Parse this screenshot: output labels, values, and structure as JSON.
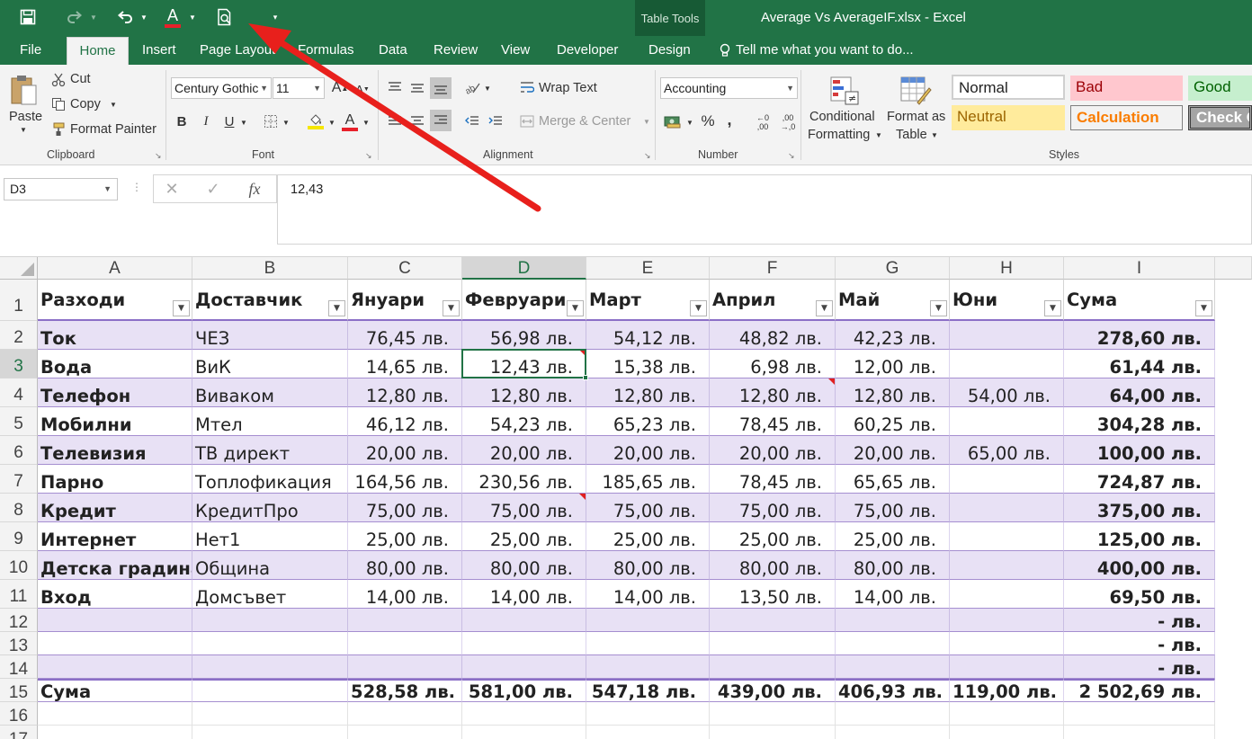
{
  "window": {
    "title": "Average Vs AverageIF.xlsx - Excel",
    "contextual_label": "Table Tools",
    "brand_color": "#217346"
  },
  "quick_access": {
    "icons": [
      "save-icon",
      "redo-icon",
      "undo-icon",
      "font-color-icon",
      "print-preview-icon",
      "customize-qat-icon"
    ]
  },
  "tabs": {
    "file": "File",
    "home": "Home",
    "insert": "Insert",
    "page_layout": "Page Layout",
    "formulas": "Formulas",
    "data": "Data",
    "review": "Review",
    "view": "View",
    "developer": "Developer",
    "design": "Design",
    "tell_me": "Tell me what you want to do..."
  },
  "ribbon": {
    "clipboard": {
      "paste": "Paste",
      "cut": "Cut",
      "copy": "Copy",
      "format_painter": "Format Painter",
      "label": "Clipboard"
    },
    "font": {
      "font_name": "Century Gothic",
      "font_size": "11",
      "bold": "B",
      "italic": "I",
      "underline": "U",
      "label": "Font"
    },
    "alignment": {
      "wrap_text": "Wrap Text",
      "merge_center": "Merge & Center",
      "label": "Alignment"
    },
    "number": {
      "format": "Accounting",
      "percent": "%",
      "comma": ",",
      "label": "Number"
    },
    "styles": {
      "conditional_formatting_1": "Conditional",
      "conditional_formatting_2": "Formatting",
      "format_as_table_1": "Format as",
      "format_as_table_2": "Table",
      "normal": "Normal",
      "bad": "Bad",
      "good": "Good",
      "neutral": "Neutral",
      "calculation": "Calculation",
      "check_cell": "Check C",
      "label": "Styles"
    }
  },
  "formula_bar": {
    "name_box": "D3",
    "cancel": "✕",
    "enter": "✓",
    "fx": "fx",
    "value": "12,43"
  },
  "sheet": {
    "columns": [
      "A",
      "B",
      "C",
      "D",
      "E",
      "F",
      "G",
      "H",
      "I"
    ],
    "selected_column": "D",
    "selected_row": "3",
    "row_numbers": [
      "1",
      "2",
      "3",
      "4",
      "5",
      "6",
      "7",
      "8",
      "9",
      "10",
      "11",
      "12",
      "13",
      "14",
      "15",
      "16",
      "17"
    ],
    "header": [
      "Разходи",
      "Доставчик",
      "Януари",
      "Февруари",
      "Март",
      "Април",
      "Май",
      "Юни",
      "Сума"
    ],
    "rows": [
      [
        "Ток",
        "ЧЕЗ",
        "76,45 лв.",
        "56,98 лв.",
        "54,12 лв.",
        "48,82 лв.",
        "42,23 лв.",
        "",
        "278,60 лв."
      ],
      [
        "Вода",
        "ВиК",
        "14,65 лв.",
        "12,43 лв.",
        "15,38 лв.",
        "6,98 лв.",
        "12,00 лв.",
        "",
        "61,44 лв."
      ],
      [
        "Телефон",
        "Виваком",
        "12,80 лв.",
        "12,80 лв.",
        "12,80 лв.",
        "12,80 лв.",
        "12,80 лв.",
        "54,00 лв.",
        "64,00 лв."
      ],
      [
        "Мобилни",
        "Мтел",
        "46,12 лв.",
        "54,23 лв.",
        "65,23 лв.",
        "78,45 лв.",
        "60,25 лв.",
        "",
        "304,28 лв."
      ],
      [
        "Телевизия",
        "ТВ директ",
        "20,00 лв.",
        "20,00 лв.",
        "20,00 лв.",
        "20,00 лв.",
        "20,00 лв.",
        "65,00 лв.",
        "100,00 лв."
      ],
      [
        "Парно",
        "Топлофикация",
        "164,56 лв.",
        "230,56 лв.",
        "185,65 лв.",
        "78,45 лв.",
        "65,65 лв.",
        "",
        "724,87 лв."
      ],
      [
        "Кредит",
        "КредитПро",
        "75,00 лв.",
        "75,00 лв.",
        "75,00 лв.",
        "75,00 лв.",
        "75,00 лв.",
        "",
        "375,00 лв."
      ],
      [
        "Интернет",
        "Нет1",
        "25,00 лв.",
        "25,00 лв.",
        "25,00 лв.",
        "25,00 лв.",
        "25,00 лв.",
        "",
        "125,00 лв."
      ],
      [
        "Детска градина",
        "Община",
        "80,00 лв.",
        "80,00 лв.",
        "80,00 лв.",
        "80,00 лв.",
        "80,00 лв.",
        "",
        "400,00 лв."
      ],
      [
        "Вход",
        "Домсъвет",
        "14,00 лв.",
        "14,00 лв.",
        "14,00 лв.",
        "13,50 лв.",
        "14,00 лв.",
        "",
        "69,50 лв."
      ],
      [
        "",
        "",
        "",
        "",
        "",
        "",
        "",
        "",
        "-     лв."
      ],
      [
        "",
        "",
        "",
        "",
        "",
        "",
        "",
        "",
        "-     лв."
      ],
      [
        "",
        "",
        "",
        "",
        "",
        "",
        "",
        "",
        "-     лв."
      ]
    ],
    "total": [
      "Сума",
      "",
      "528,58 лв.",
      "581,00 лв.",
      "547,18 лв.",
      "439,00 лв.",
      "406,93 лв.",
      "119,00 лв.",
      "2 502,69 лв."
    ],
    "band_color": "#e8e1f5",
    "comment_cells": [
      "D3",
      "F4",
      "D8"
    ],
    "annotation": "red-arrow-pointing-to-print-preview"
  }
}
